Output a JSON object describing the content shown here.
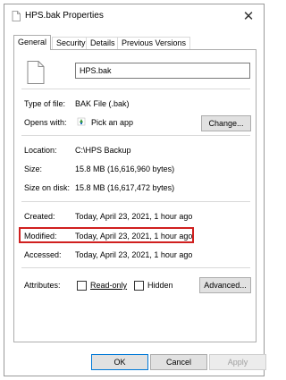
{
  "window": {
    "title": "HPS.bak Properties",
    "close_icon": "close-icon"
  },
  "tabs": [
    {
      "label": "General",
      "active": true
    },
    {
      "label": "Security",
      "active": false
    },
    {
      "label": "Details",
      "active": false
    },
    {
      "label": "Previous Versions",
      "active": false
    }
  ],
  "file": {
    "name": "HPS.bak",
    "icon": "file-icon"
  },
  "properties": {
    "type_label": "Type of file:",
    "type_value": "BAK File (.bak)",
    "opens_label": "Opens with:",
    "opens_value": "Pick an app",
    "change_button": "Change...",
    "location_label": "Location:",
    "location_value": "C:\\HPS Backup",
    "size_label": "Size:",
    "size_value": "15.8 MB (16,616,960 bytes)",
    "size_disk_label": "Size on disk:",
    "size_disk_value": "15.8 MB (16,617,472 bytes)",
    "created_label": "Created:",
    "created_value": "Today, April 23, 2021, 1 hour ago",
    "modified_label": "Modified:",
    "modified_value": "Today, April 23, 2021, 1 hour ago",
    "accessed_label": "Accessed:",
    "accessed_value": "Today, April 23, 2021, 1 hour ago",
    "attributes_label": "Attributes:",
    "readonly_label": "Read-only",
    "hidden_label": "Hidden",
    "advanced_button": "Advanced..."
  },
  "footer": {
    "ok": "OK",
    "cancel": "Cancel",
    "apply": "Apply"
  },
  "colors": {
    "highlight": "#d0201f",
    "ok_border": "#0078d7"
  }
}
